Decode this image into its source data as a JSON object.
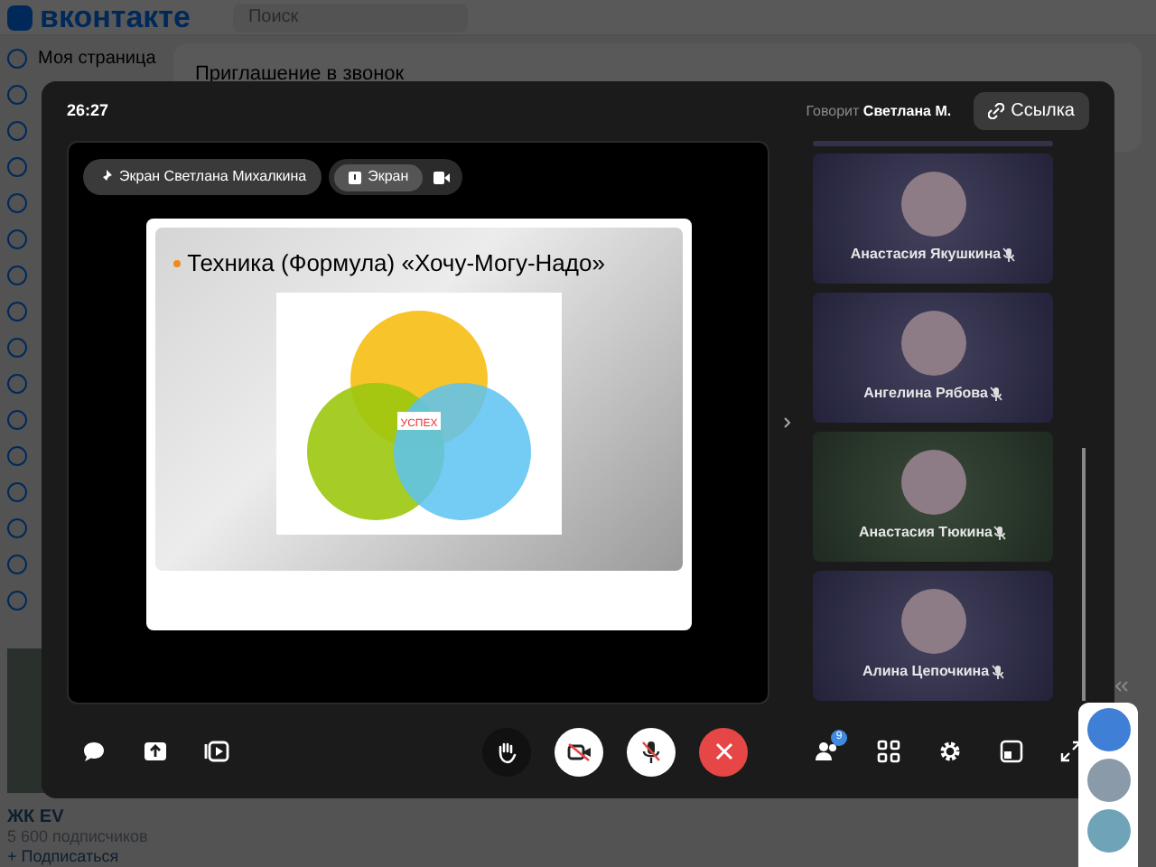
{
  "page": {
    "logo": "вконтакте",
    "search": {
      "placeholder": "Поиск"
    },
    "sidebar": [
      {
        "label": "Моя страница"
      }
    ],
    "content_title": "Приглашение в звонок",
    "community": {
      "name": "ЖК EV",
      "followers": "5 600 подписчиков",
      "subscribe": "+ Подписаться"
    }
  },
  "call": {
    "timer": "26:27",
    "speaking_prefix": "Говорит",
    "speaking_name": "Светлана М.",
    "link_button": "Ссылка",
    "pills": [
      {
        "label": "Экран Светлана Михалкина",
        "kind": "pin"
      },
      {
        "label": "Экран",
        "kind": "screen",
        "selected": true
      }
    ],
    "slide": {
      "title": "Техника (Формула) «Хочу-Могу-Надо»",
      "diagram_center": "УСПЕХ"
    },
    "participants": [
      {
        "name": "Анастасия Якушкина",
        "muted": true,
        "speaking": false
      },
      {
        "name": "Ангелина Рябова",
        "muted": true,
        "speaking": false
      },
      {
        "name": "Анастасия Тюкина",
        "muted": true,
        "speaking": true
      },
      {
        "name": "Алина Цепочкина",
        "muted": true,
        "speaking": false
      }
    ],
    "controls": {
      "camera_on": false,
      "mic_on": false,
      "participants_badge": "9"
    }
  }
}
